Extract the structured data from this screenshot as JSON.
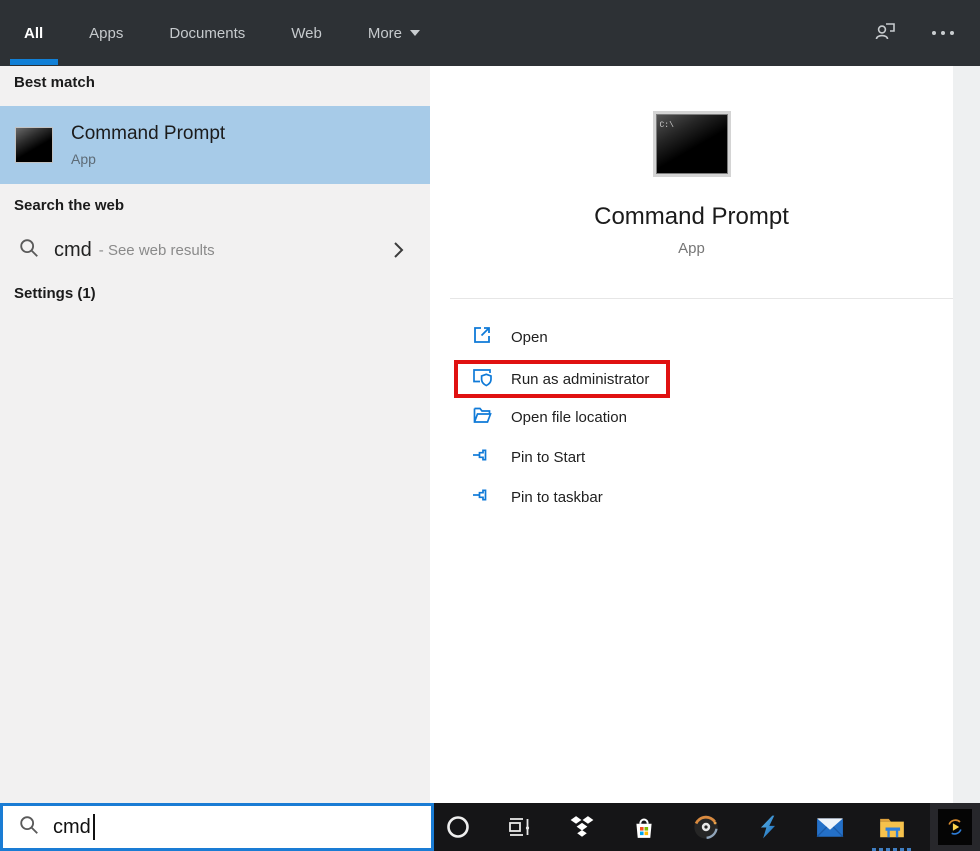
{
  "topbar": {
    "tabs": [
      {
        "label": "All",
        "active": true
      },
      {
        "label": "Apps",
        "active": false
      },
      {
        "label": "Documents",
        "active": false
      },
      {
        "label": "Web",
        "active": false
      },
      {
        "label": "More",
        "active": false,
        "has_dropdown": true
      }
    ],
    "icons": [
      "user-account-icon",
      "ellipsis-menu-icon"
    ]
  },
  "left_panel": {
    "best_match_header": "Best match",
    "best_match": {
      "title": "Command Prompt",
      "subtitle": "App",
      "icon": "command-prompt-icon"
    },
    "search_web_header": "Search the web",
    "web_result": {
      "query": "cmd",
      "note": "- See web results",
      "icon": "search-icon",
      "chevron": "chevron-right-icon"
    },
    "settings_header": "Settings (1)"
  },
  "right_panel": {
    "app": {
      "title": "Command Prompt",
      "subtitle": "App",
      "icon": "command-prompt-icon-large",
      "icon_text": "C:\\"
    },
    "actions": [
      {
        "label": "Open",
        "icon": "open-external-icon",
        "highlighted": false
      },
      {
        "label": "Run as administrator",
        "icon": "admin-shield-icon",
        "highlighted": true
      },
      {
        "label": "Open file location",
        "icon": "folder-icon",
        "highlighted": false
      },
      {
        "label": "Pin to Start",
        "icon": "pin-icon",
        "highlighted": false
      },
      {
        "label": "Pin to taskbar",
        "icon": "pin-icon",
        "highlighted": false
      }
    ]
  },
  "search_bar": {
    "value": "cmd",
    "icon": "search-icon"
  },
  "taskbar": {
    "icons": [
      "cortana-icon",
      "task-view-icon",
      "dropbox-icon",
      "microsoft-store-icon",
      "disc-icon",
      "lightning-icon",
      "mail-icon",
      "file-explorer-icon",
      "media-app-icon"
    ],
    "active_app": "file-explorer"
  },
  "colors": {
    "accent_blue": "#1180d7",
    "action_icon_blue": "#0f7ad8",
    "selection_blue": "#a7cbe8",
    "highlight_red": "#e01111",
    "topbar_bg": "#2d3135",
    "left_panel_bg": "#f2f1f1",
    "taskbar_bg": "#151517"
  }
}
